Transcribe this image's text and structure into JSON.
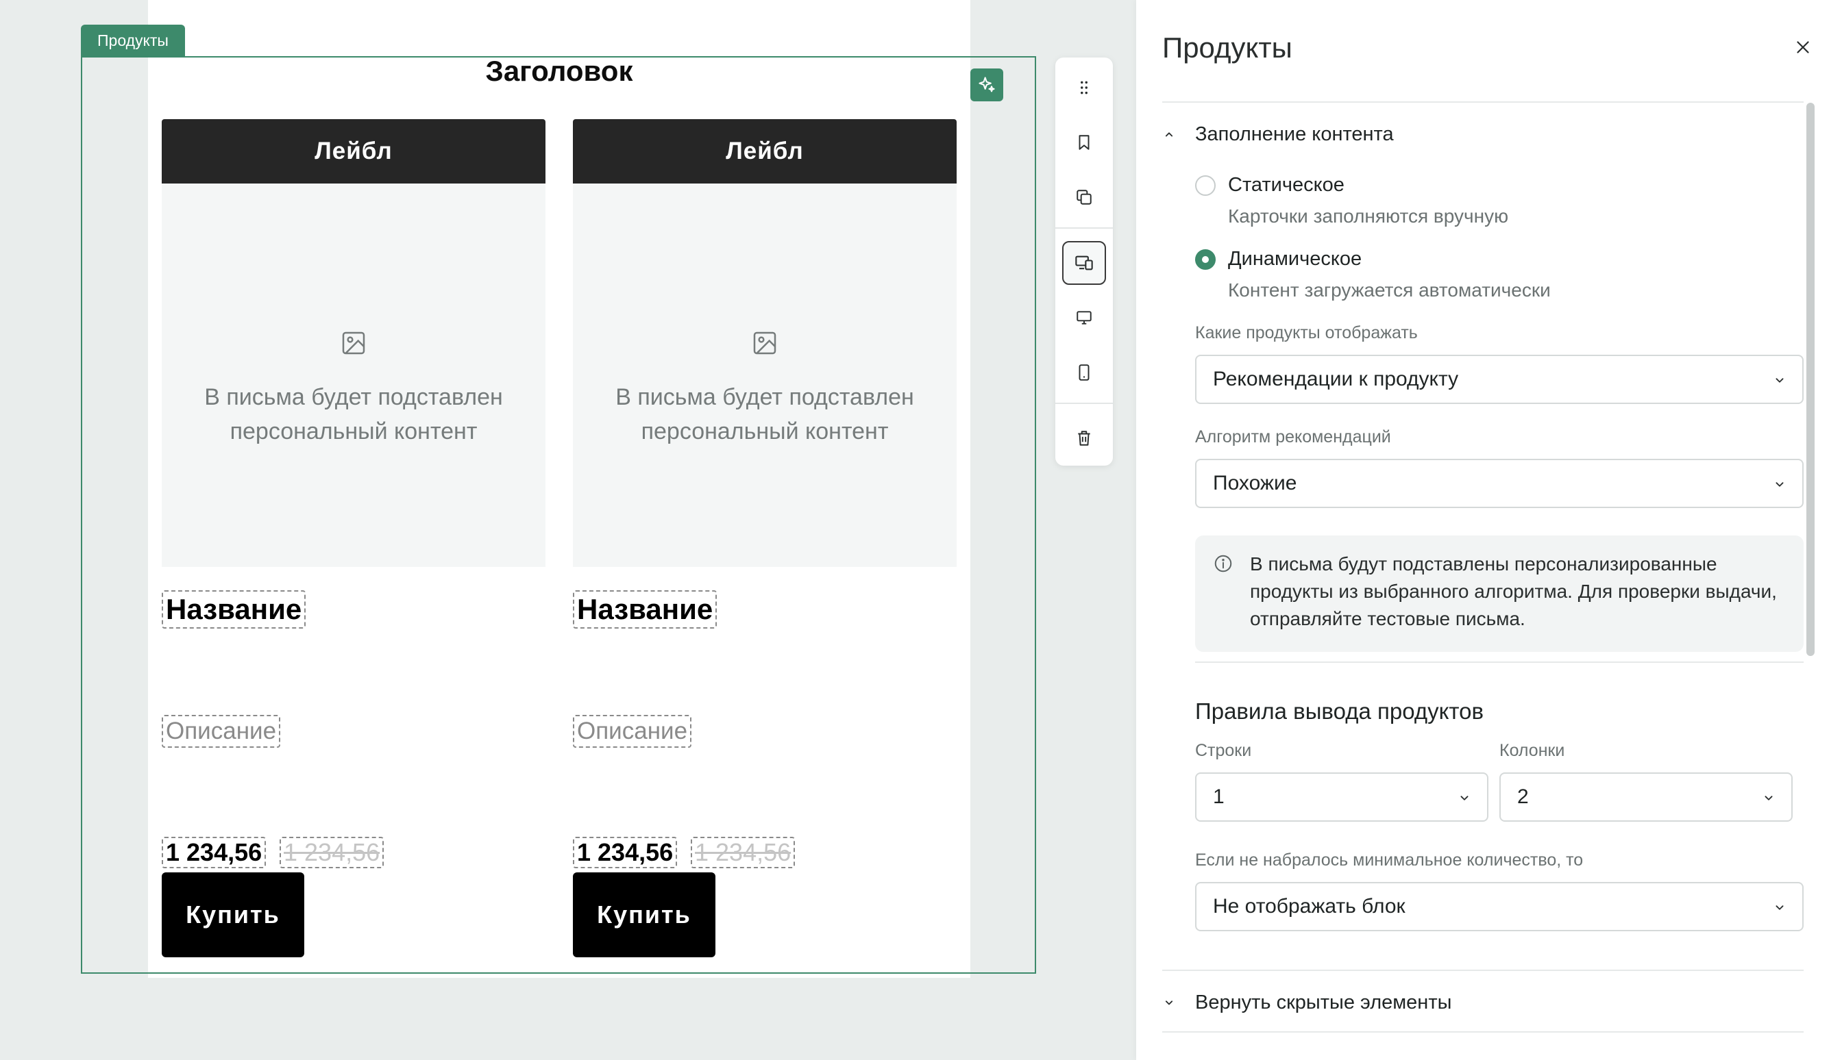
{
  "canvas": {
    "block_tag": "Продукты",
    "block_title": "Заголовок",
    "cards": [
      {
        "label": "Лейбл",
        "placeholder": "В письма будет подставлен персональный контент",
        "name": "Название",
        "description": "Описание",
        "price": "1 234,56",
        "old_price": "1 234,56",
        "buy": "Купить"
      },
      {
        "label": "Лейбл",
        "placeholder": "В письма будет подставлен персональный контент",
        "name": "Название",
        "description": "Описание",
        "price": "1 234,56",
        "old_price": "1 234,56",
        "buy": "Купить"
      }
    ]
  },
  "toolbar": {
    "items": [
      "drag-handle-icon",
      "bookmark-icon",
      "copy-icon",
      "responsive-icon",
      "desktop-icon",
      "mobile-icon",
      "trash-icon"
    ],
    "active": "responsive-icon"
  },
  "panel": {
    "title": "Продукты",
    "content_section": {
      "title": "Заполнение контента",
      "options": [
        {
          "label": "Статическое",
          "description": "Карточки заполняются вручную",
          "selected": false
        },
        {
          "label": "Динамическое",
          "description": "Контент загружается автоматически",
          "selected": true
        }
      ],
      "products_label": "Какие продукты отображать",
      "products_value": "Рекомендации к продукту",
      "algorithm_label": "Алгоритм рекомендаций",
      "algorithm_value": "Похожие",
      "info": "В письма будут подставлены персонализированные продукты из выбранного алгоритма. Для проверки выдачи, отправляйте тестовые письма."
    },
    "rules": {
      "title": "Правила вывода продуктов",
      "rows_label": "Строки",
      "rows_value": "1",
      "cols_label": "Колонки",
      "cols_value": "2",
      "min_label": "Если не набралось минимальное количество, то",
      "min_value": "Не отображать блок"
    },
    "hidden_section": {
      "title": "Вернуть скрытые элементы"
    }
  },
  "colors": {
    "accent": "#3d8a6b",
    "card_label_bg": "#262626",
    "canvas_bg": "#e9edec"
  }
}
